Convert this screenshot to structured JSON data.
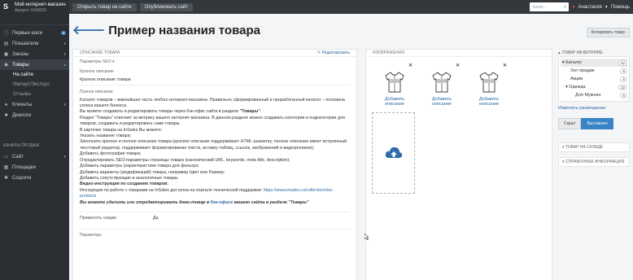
{
  "app": {
    "store_name": "Мой интернет-магазин",
    "account": "Аккаунт 1048029"
  },
  "sidebar": {
    "items": [
      {
        "label": "Первые шаги",
        "icon": "info-icon",
        "badge": "6"
      },
      {
        "label": "Показатели",
        "icon": "chart-icon"
      },
      {
        "label": "Заказы",
        "icon": "cart-icon"
      },
      {
        "label": "Товары",
        "icon": "tag-icon"
      },
      {
        "label": "Клиенты",
        "icon": "users-icon"
      },
      {
        "label": "Диалоги",
        "icon": "chat-icon"
      }
    ],
    "sub_items": [
      "На сайте",
      "Импорт/Экспорт",
      "Отзывы"
    ],
    "section_title": "КАНАЛЫ ПРОДАЖ",
    "channels": [
      {
        "label": "Сайт",
        "icon": "monitor-icon"
      },
      {
        "label": "Площадки",
        "icon": "store-icon"
      },
      {
        "label": "Соцсети",
        "icon": "social-icon"
      }
    ]
  },
  "topbar": {
    "open_store": "Открыть товар на сайте",
    "publish_store": "Опубликовать сайт",
    "search_placeholder": "поиск...",
    "user": "Анастасия",
    "help": "Помощь"
  },
  "page": {
    "title": "Пример названия товара",
    "copy_button": "Копировать товар"
  },
  "description": {
    "header": "ОПИСАНИЕ ТОВАРА",
    "edit_link": "Редактировать",
    "seo_label": "Параметры SEO",
    "short_label": "Краткое описание",
    "short_value": "Краткое описание товара",
    "full_label": "Полное описание",
    "full_lines": [
      {
        "t": "Каталог товаров – важнейшая часть любого интернет-магазина. Правильно сформированный и проработанный каталог – половина успеха вашего бизнеса."
      },
      {
        "t": "Вы можете создавать и редактировать товары через бэк-офис сайта в разделе ",
        "b": "\"Товары\"",
        "t2": "."
      },
      {
        "t": "Раздел \"Товары\" отвечает за витрину вашего интернет-магазина. В данном разделе можно создавать категории и подкатегории для товаров, создавать и редактировать сами товары."
      },
      {
        "t": "В карточке товара на InSales Вы можете:"
      },
      {
        "t": "Указать название товара;"
      },
      {
        "t": "Заполнить краткое и полное описание товара (краткое описание поддерживает HTML-разметку; полное описание имеет встроенный текстовый редактор, поддерживает форматирование текста, вставку таблиц, ссылок, изображений и видеороликов);"
      },
      {
        "t": "Добавить фотографии товара;"
      },
      {
        "t": "Отредактировать SEO-параметры страницы товара (канонический URL, keywords, meta title, description);"
      },
      {
        "t": "Добавить параметры (характеристики товара для фильтра;"
      },
      {
        "t": "Добавить варианты (модификаций) товара, например Цвет или Размер;"
      },
      {
        "t": "Добавить сопутствующие и аналогичные товары."
      }
    ],
    "video_title": "Видео-инструкция по созданию товаров:",
    "instruction_text": "Инструкция по работе с товарами на InSales доступна на портале технической поддержки: ",
    "instruction_link": "https://www.insales.ru/collection/doc-products",
    "footer_before": "Вы можете удалить или отредактировать демо-товар в ",
    "footer_link": "бэк-офисе",
    "footer_after": " вашего сайта в разделе \"Товары\"",
    "discount_label": "Применять скидки",
    "discount_value": "Да",
    "params_label": "Параметры"
  },
  "images": {
    "header": "ИЗОБРАЖЕНИЯ",
    "cards": [
      {
        "caption": "Добавить описание",
        "icon": "shirt-icon"
      },
      {
        "caption": "Добавить описание",
        "icon": "shirt-icon"
      },
      {
        "caption": "Добавить описание",
        "icon": "shirt-icon"
      }
    ],
    "upload_icon": "cloud-upload-icon"
  },
  "storefront": {
    "header": "ТОВАР НА ВИТРИНЕ",
    "tree": [
      {
        "label": "Каталог",
        "count": "12",
        "level": 1,
        "caret": "▾"
      },
      {
        "label": "Хит продаж",
        "count": "6",
        "level": 2,
        "caret": ""
      },
      {
        "label": "Акции",
        "count": "6",
        "level": 2,
        "caret": ""
      },
      {
        "label": "Одежда",
        "count": "12",
        "level": 2,
        "caret": "▾"
      },
      {
        "label": "Для Мужчин",
        "count": "6",
        "level": 3,
        "caret": ""
      }
    ],
    "change_placement": "Изменить размещение",
    "hide_button": "Скрыт",
    "show_button": "Выставлен",
    "warehouse_header": "ТОВАР НА СКЛАДЕ",
    "reference_header": "СПРАВОЧНАЯ ИНФОРМАЦИЯ"
  },
  "colors": {
    "sidebar_bg": "#2b2f33",
    "accent": "#3a84c5",
    "link": "#2d6ba9",
    "back_arrow": "#2d6ba9"
  }
}
